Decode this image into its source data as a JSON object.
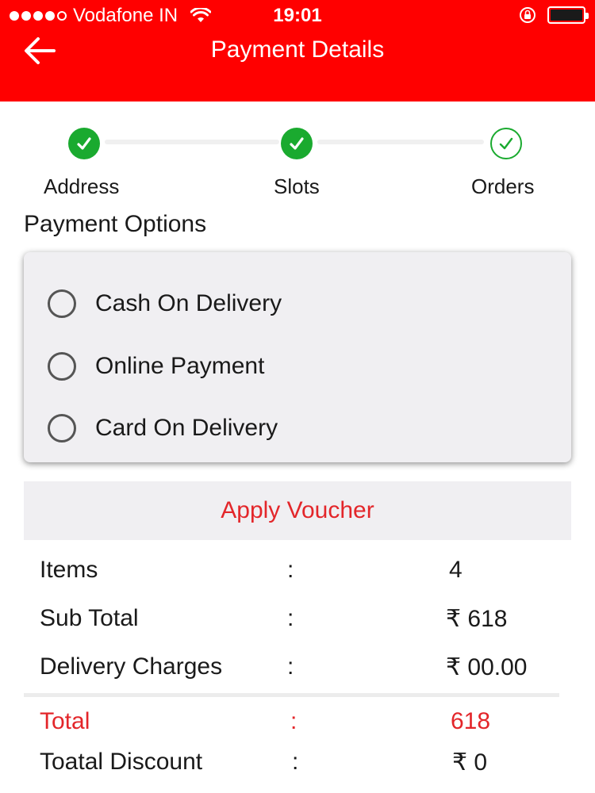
{
  "status_bar": {
    "carrier": "Vodafone IN",
    "time": "19:01",
    "signal_bars_filled": 4,
    "signal_bars_total": 5,
    "battery_level": 1.0
  },
  "header": {
    "title": "Payment Details",
    "back_icon": "arrow-left-icon",
    "background_color": "#ff0000"
  },
  "stepper": {
    "steps": [
      {
        "label": "Address",
        "status": "done"
      },
      {
        "label": "Slots",
        "status": "done"
      },
      {
        "label": "Orders",
        "status": "pending"
      }
    ],
    "accent_color": "#1aaa2f"
  },
  "payment": {
    "section_title": "Payment Options",
    "options": [
      {
        "label": "Cash On Delivery",
        "selected": false
      },
      {
        "label": "Online Payment",
        "selected": false
      },
      {
        "label": "Card On Delivery",
        "selected": false
      }
    ]
  },
  "voucher": {
    "label": "Apply Voucher",
    "color": "#e3262a"
  },
  "summary": {
    "separator": ":",
    "rows": [
      {
        "label": "Items",
        "value": "4"
      },
      {
        "label": "Sub Total",
        "value": "₹ 618"
      },
      {
        "label": "Delivery Charges",
        "value": "₹ 00.00"
      },
      {
        "label": "Total",
        "value": "618"
      },
      {
        "label": "Toatal Discount",
        "value": "₹ 0"
      }
    ]
  }
}
